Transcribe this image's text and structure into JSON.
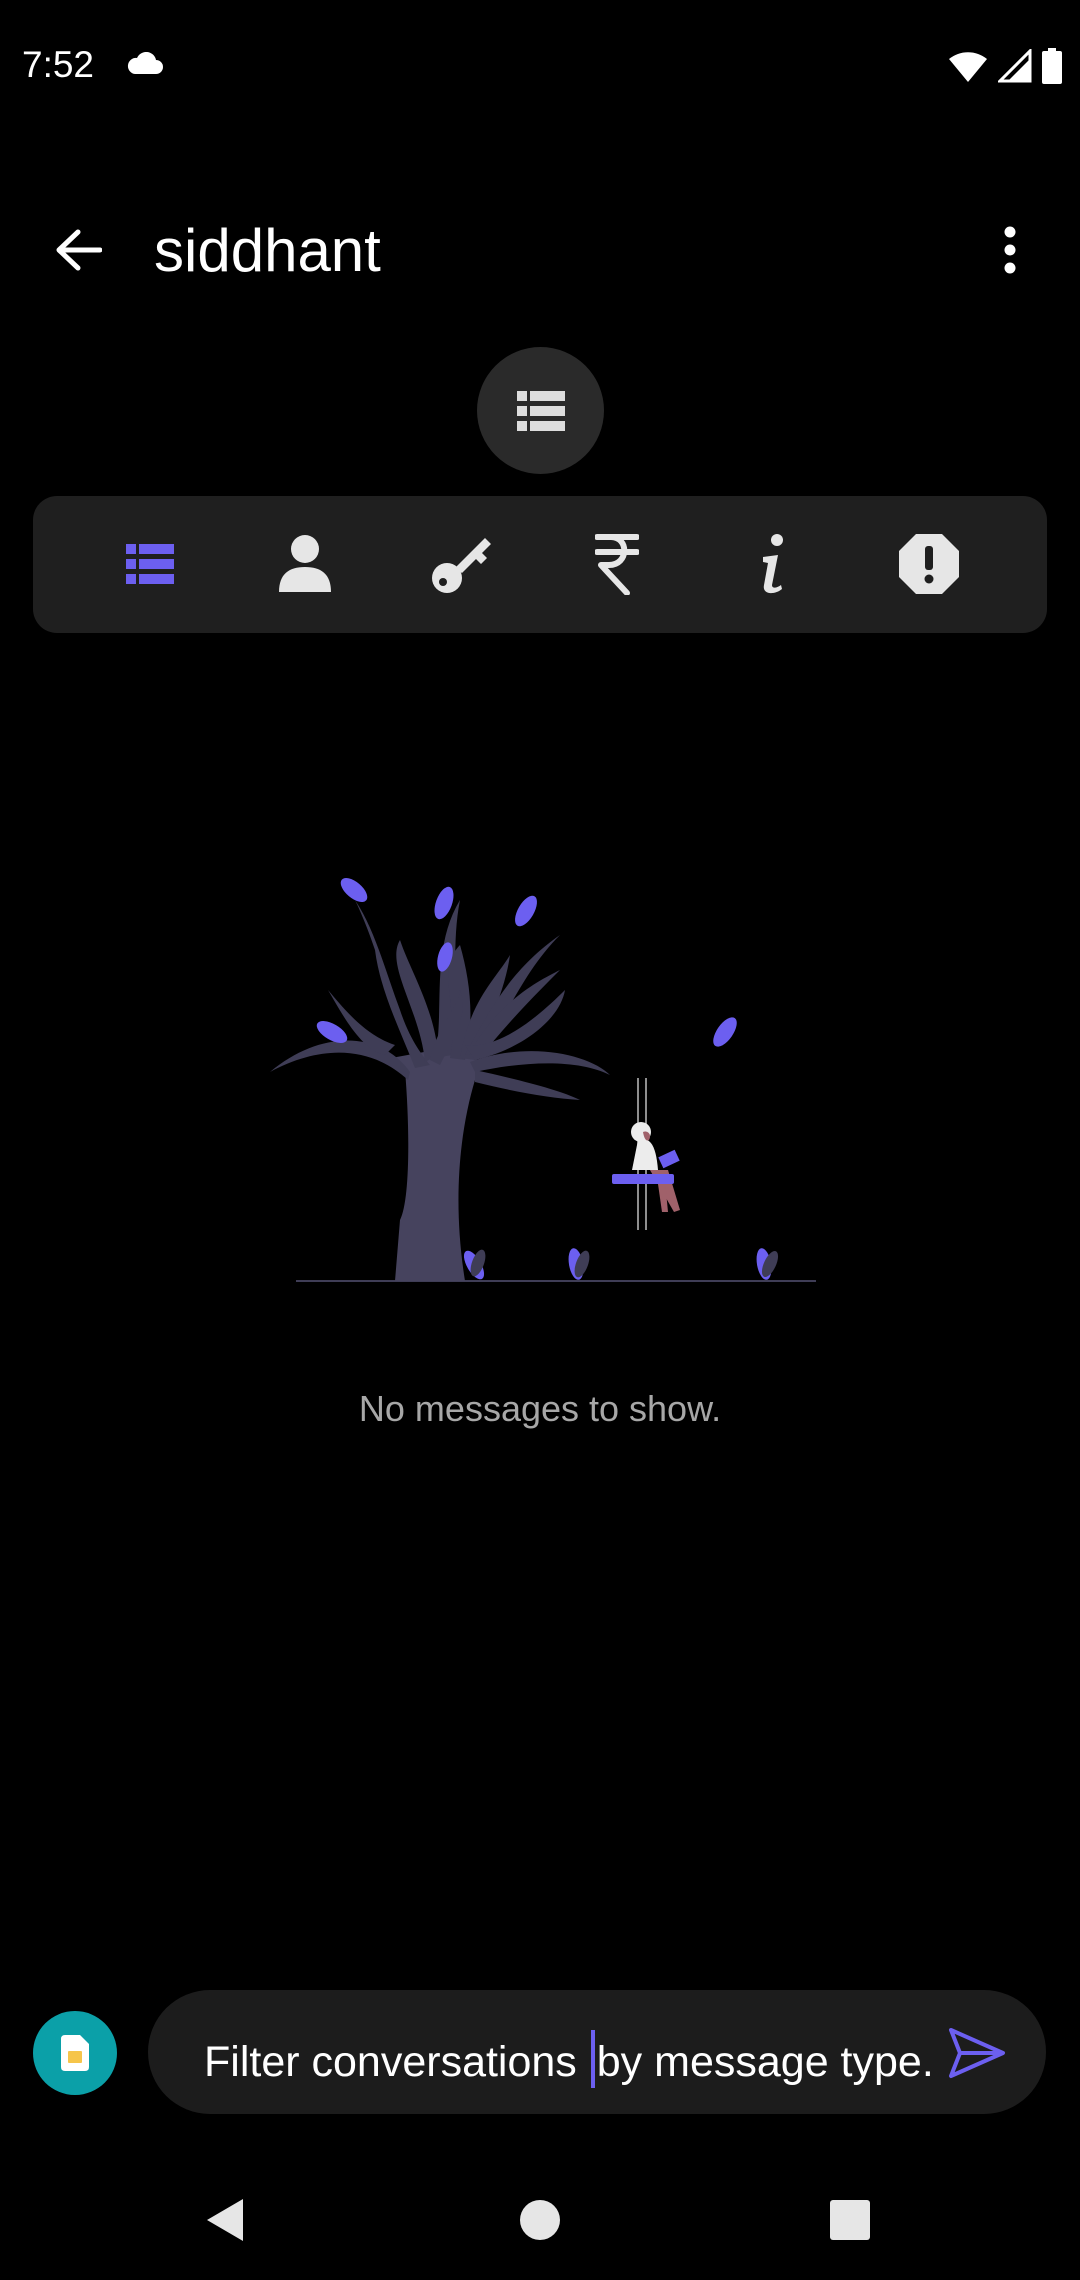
{
  "status_bar": {
    "time": "7:52",
    "left_icons": [
      "cloud-icon"
    ],
    "right_icons": [
      "wifi-icon",
      "cell-signal-icon",
      "battery-icon"
    ]
  },
  "header": {
    "title": "siddhant",
    "back_icon": "arrow-back-icon",
    "menu_icon": "more-vert-icon"
  },
  "view_toggle": {
    "icon": "list-icon"
  },
  "filters": {
    "items": [
      {
        "icon": "list-icon",
        "selected": true
      },
      {
        "icon": "person-icon",
        "selected": false
      },
      {
        "icon": "key-icon",
        "selected": false
      },
      {
        "icon": "rupee-icon",
        "selected": false
      },
      {
        "icon": "info-icon",
        "selected": false
      },
      {
        "icon": "alert-icon",
        "selected": false
      }
    ]
  },
  "empty_state": {
    "message": "No messages to show."
  },
  "composer": {
    "sim_icon": "sim-card-icon",
    "text_before_cursor": "Filter conversations ",
    "text_after_cursor": "by message type.",
    "send_icon": "send-icon"
  },
  "navigation": {
    "icons": [
      "back-triangle-icon",
      "home-circle-icon",
      "recents-square-icon"
    ]
  },
  "colors": {
    "accent": "#6c5ff0",
    "background": "#000000",
    "surface": "#1f1f1f",
    "icon_default": "#e6e6e6",
    "sim_button": "#0ba0a8",
    "tree": "#3f3d56"
  }
}
